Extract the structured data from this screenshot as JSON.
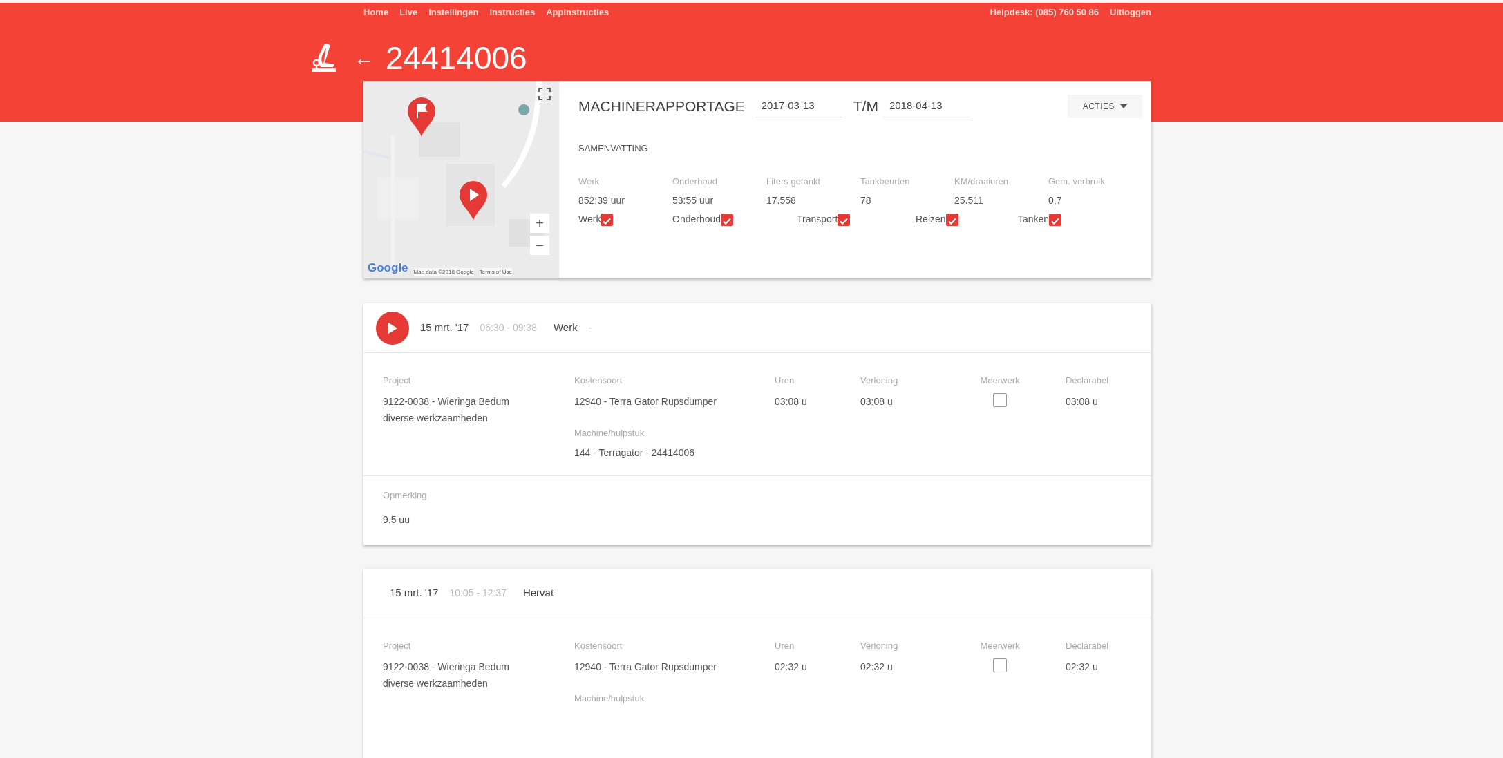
{
  "nav": {
    "links": [
      "Home",
      "Live",
      "Instellingen",
      "Instructies",
      "Appinstructies"
    ],
    "helpdesk": "Helpdesk: (085) 760 50 86",
    "logout": "Uitloggen"
  },
  "header": {
    "back": "←",
    "title": "24414006"
  },
  "summary": {
    "map": {
      "kind": "picture",
      "zoom_in": "+",
      "zoom_out": "−",
      "logo": "Google",
      "map_data": "Map data ©2018 Google",
      "terms": "Terms of Use"
    },
    "title": "MACHINERAPPORTAGE",
    "date_from": "2017-03-13",
    "to_label": "T/M",
    "date_to": "2018-04-13",
    "actions": "ACTIES",
    "section": "SAMENVATTING",
    "stats": [
      {
        "label": "Werk",
        "value": "852:39 uur"
      },
      {
        "label": "Onderhoud",
        "value": "53:55 uur"
      },
      {
        "label": "Liters getankt",
        "value": "17.558"
      },
      {
        "label": "Tankbeurten",
        "value": "78"
      },
      {
        "label": "KM/draaiuren",
        "value": "25.511"
      },
      {
        "label": "Gem. verbruik",
        "value": "0,7"
      }
    ],
    "filters": [
      {
        "label": "Werk",
        "checked": true
      },
      {
        "label": "Onderhoud",
        "checked": true
      },
      {
        "label": "Transport",
        "checked": true
      },
      {
        "label": "Reizen",
        "checked": true
      },
      {
        "label": "Tanken",
        "checked": true
      }
    ]
  },
  "entries": [
    {
      "kind": "start",
      "date": "15 mrt. '17",
      "time": "06:30 - 09:38",
      "type": "Werk",
      "suffix": "-",
      "columns": [
        {
          "kind": "text",
          "label": "Project",
          "value": "9122-0038 - Wieringa Bedum diverse werkzaamheden"
        },
        {
          "kind": "text",
          "label": "Kostensoort",
          "value": "12940 - Terra Gator Rupsdumper",
          "extra": {
            "label": "Machine/hulpstuk",
            "value": "144 - Terragator - 24414006"
          }
        },
        {
          "kind": "text",
          "label": "Uren",
          "value": "03:08 u"
        },
        {
          "kind": "text",
          "label": "Verloning",
          "value": "03:08 u"
        },
        {
          "kind": "checkbox",
          "label": "Meerwerk",
          "checked": false
        },
        {
          "kind": "text",
          "label": "Declarabel",
          "value": "03:08 u"
        }
      ],
      "remark": {
        "label": "Opmerking",
        "value": "9.5 uu"
      }
    },
    {
      "kind": "resume",
      "date": "15 mrt. '17",
      "time": "10:05 - 12:37",
      "type": "Hervat",
      "columns": [
        {
          "kind": "text",
          "label": "Project",
          "value": "9122-0038 - Wieringa Bedum diverse werkzaamheden"
        },
        {
          "kind": "text",
          "label": "Kostensoort",
          "value": "12940 - Terra Gator Rupsdumper",
          "extra": {
            "label": "Machine/hulpstuk"
          }
        },
        {
          "kind": "text",
          "label": "Uren",
          "value": "02:32 u"
        },
        {
          "kind": "text",
          "label": "Verloning",
          "value": "02:32 u"
        },
        {
          "kind": "checkbox",
          "label": "Meerwerk",
          "checked": false
        },
        {
          "kind": "text",
          "label": "Declarabel",
          "value": "02:32 u"
        }
      ]
    }
  ]
}
